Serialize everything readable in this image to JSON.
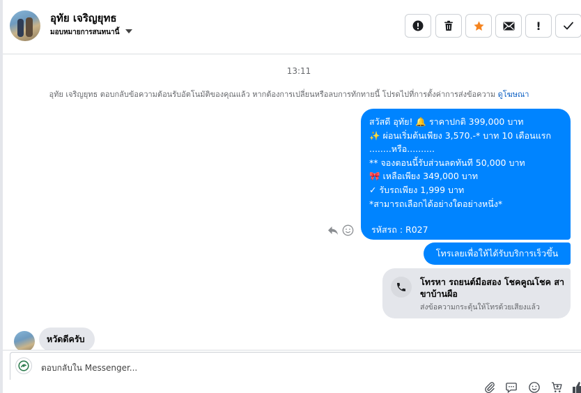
{
  "header": {
    "contact_name": "อุทัย เจริญยุทธ",
    "assign_label": "มอบหมายการสนทนานี้",
    "actions": [
      {
        "name": "spam",
        "icon": "alert-circle-icon"
      },
      {
        "name": "delete",
        "icon": "trash-icon"
      },
      {
        "name": "star",
        "icon": "star-icon",
        "color": "#f5841f"
      },
      {
        "name": "mark-unread",
        "icon": "envelope-icon"
      },
      {
        "name": "follow-up",
        "icon": "exclamation-icon",
        "label": "!"
      },
      {
        "name": "done",
        "icon": "check-icon"
      }
    ]
  },
  "conversation": {
    "timestamp": "13:11",
    "notice": "อุทัย เจริญยุทธ ตอบกลับข้อความต้อนรับอัตโนมัติของคุณแล้ว หากต้องการเปลี่ยนหรือลบการทักทายนี้ โปรดไปที่การตั้งค่าการส่งข้อความ",
    "notice_link": "ดูโฆษณา",
    "outgoing_message": {
      "lines": [
        "สวัสดี อุทัย! 🔔  ราคาปกติ 399,000 บาท",
        "✨  ผ่อนเริ่มต้นเพียง 3,570.-* บาท 10 เดือนแรก",
        "........หรือ..........",
        "** จองตอนนี้รับส่วนลดทันที 50,000 บาท",
        "🎀  เหลือเพียง 349,000 บาท",
        "✓ รับรถเพียง 1,999 บาท",
        "*สามารถเลือกได้อย่างใดอย่างหนึ่ง*"
      ],
      "code": "รหัสรถ : R027"
    },
    "cta_message": "โทรเลยเพื่อให้ได้รับบริการเร็วขึ้น",
    "call_card": {
      "title": "โทรหา รถยนต์มือสอง โชคคูณโชค สาขาบ้านผือ",
      "subtitle": "ส่งข้อความกระตุ้นให้โทรด้วยเสียงแล้ว"
    },
    "incoming_message": "หวัดดีครับ",
    "accent_color": "#0084ff"
  },
  "composer": {
    "placeholder": "ตอบกลับใน Messenger...",
    "tools": [
      "paperclip-icon",
      "saved-replies-icon",
      "emoji-icon",
      "cart-icon",
      "like-icon"
    ]
  }
}
